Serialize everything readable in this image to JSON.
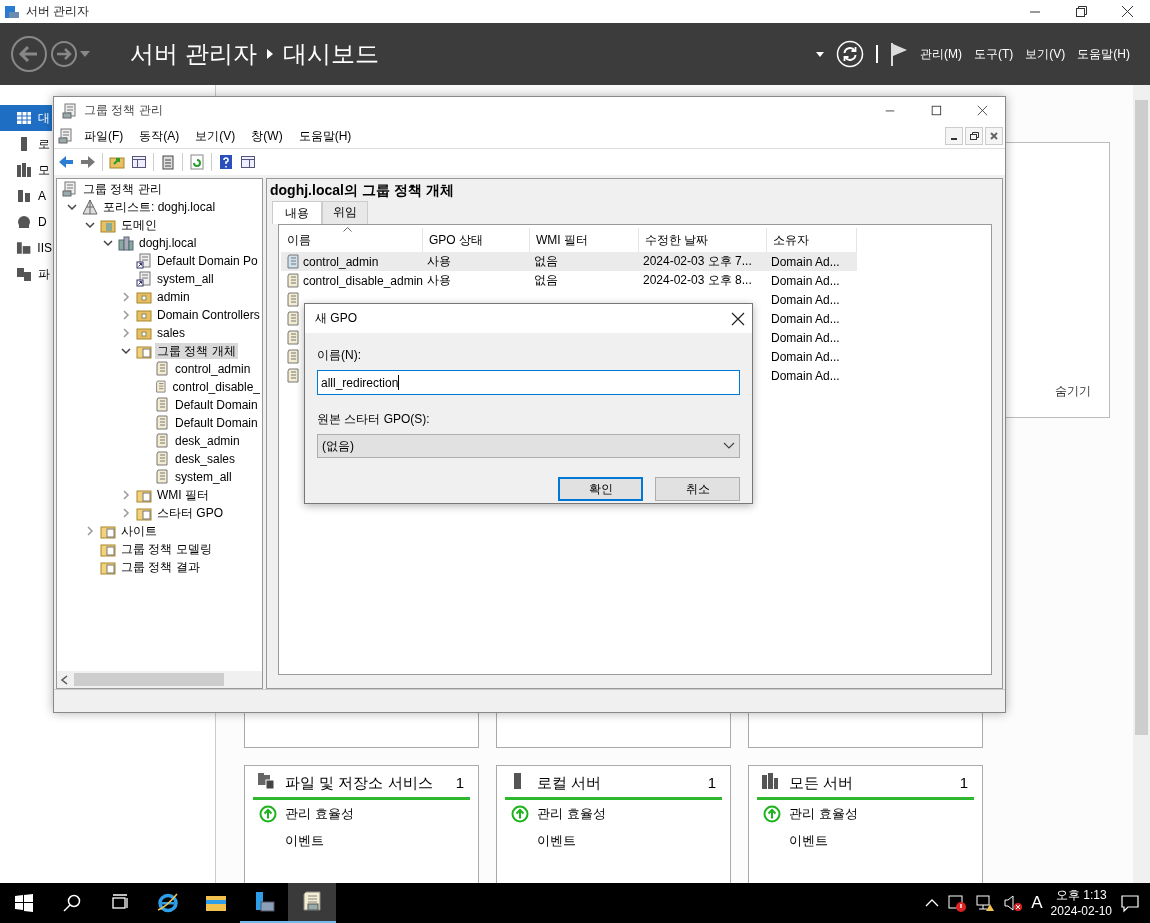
{
  "server_manager": {
    "title": "서버 관리자",
    "breadcrumb": [
      "서버 관리자",
      "대시보드"
    ],
    "menu": [
      "관리(M)",
      "도구(T)",
      "보기(V)",
      "도움말(H)"
    ],
    "sidebar": [
      {
        "label": "대",
        "selected": true
      },
      {
        "label": "로",
        "selected": false
      },
      {
        "label": "모",
        "selected": false
      },
      {
        "label": "A",
        "selected": false
      },
      {
        "label": "D",
        "selected": false
      },
      {
        "label": "IIS",
        "selected": false
      },
      {
        "label": "파",
        "selected": false
      }
    ],
    "hide_label": "숨기기",
    "tiles": [
      {
        "kind": "files",
        "title": "파일 및 저장소 서비스",
        "count": "1",
        "rows": [
          "관리 효율성",
          "이벤트"
        ]
      },
      {
        "kind": "local",
        "title": "로컬 서버",
        "count": "1",
        "rows": [
          "관리 효율성",
          "이벤트"
        ]
      },
      {
        "kind": "all",
        "title": "모든 서버",
        "count": "1",
        "rows": [
          "관리 효율성",
          "이벤트"
        ]
      }
    ]
  },
  "gpm": {
    "title": "그룹 정책 관리",
    "menu": [
      "파일(F)",
      "동작(A)",
      "보기(V)",
      "창(W)",
      "도움말(H)"
    ],
    "tree": [
      {
        "label": "그룹 정책 관리",
        "kind": "console",
        "selected": false,
        "children": [
          {
            "label": "포리스트: doghj.local",
            "kind": "forest",
            "expanded": true,
            "selected": false,
            "children": [
              {
                "label": "도메인",
                "kind": "domains",
                "expanded": true,
                "selected": false,
                "children": [
                  {
                    "label": "doghj.local",
                    "kind": "domain",
                    "expanded": true,
                    "selected": false,
                    "children": [
                      {
                        "label": "Default Domain Po",
                        "kind": "link",
                        "selected": false
                      },
                      {
                        "label": "system_all",
                        "kind": "link",
                        "selected": false
                      },
                      {
                        "label": "admin",
                        "kind": "ou",
                        "expanded": false,
                        "selected": false
                      },
                      {
                        "label": "Domain Controllers",
                        "kind": "ou",
                        "expanded": false,
                        "selected": false
                      },
                      {
                        "label": "sales",
                        "kind": "ou",
                        "expanded": false,
                        "selected": false
                      },
                      {
                        "label": "그룹 정책 개체",
                        "kind": "folder",
                        "expanded": true,
                        "selected": true,
                        "children": [
                          {
                            "label": "control_admin",
                            "kind": "gpo",
                            "selected": false
                          },
                          {
                            "label": "control_disable_",
                            "kind": "gpo",
                            "selected": false
                          },
                          {
                            "label": "Default Domain",
                            "kind": "gpo",
                            "selected": false
                          },
                          {
                            "label": "Default Domain",
                            "kind": "gpo",
                            "selected": false
                          },
                          {
                            "label": "desk_admin",
                            "kind": "gpo",
                            "selected": false
                          },
                          {
                            "label": "desk_sales",
                            "kind": "gpo",
                            "selected": false
                          },
                          {
                            "label": "system_all",
                            "kind": "gpo",
                            "selected": false
                          }
                        ]
                      },
                      {
                        "label": "WMI 필터",
                        "kind": "folder",
                        "expanded": false,
                        "selected": false
                      },
                      {
                        "label": "스타터 GPO",
                        "kind": "folder",
                        "expanded": false,
                        "selected": false
                      }
                    ]
                  }
                ]
              },
              {
                "label": "사이트",
                "kind": "folder",
                "expanded": false,
                "selected": false
              },
              {
                "label": "그룹 정책 모델링",
                "kind": "folder",
                "selected": false
              },
              {
                "label": "그룹 정책 결과",
                "kind": "folder",
                "selected": false
              }
            ]
          }
        ]
      }
    ],
    "pane_title": "doghj.local의 그룹 정책 개체",
    "tabs": [
      {
        "label": "내용",
        "selected": true
      },
      {
        "label": "위임",
        "selected": false
      }
    ],
    "table": {
      "columns": [
        "이름",
        "GPO 상태",
        "WMI 필터",
        "수정한 날짜",
        "소유자"
      ],
      "rows": [
        {
          "selected": true,
          "name": "control_admin",
          "status": "사용",
          "wmi": "없음",
          "date": "2024-02-03 오후 7...",
          "owner": "Domain Ad..."
        },
        {
          "selected": false,
          "name": "control_disable_admin",
          "status": "사용",
          "wmi": "없음",
          "date": "2024-02-03 오후 8...",
          "owner": "Domain Ad..."
        },
        {
          "selected": false,
          "owner": "Domain Ad..."
        },
        {
          "selected": false,
          "owner": "Domain Ad..."
        },
        {
          "selected": false,
          "owner": "Domain Ad..."
        },
        {
          "selected": false,
          "owner": "Domain Ad..."
        },
        {
          "selected": false,
          "owner": "Domain Ad..."
        }
      ]
    }
  },
  "dialog": {
    "title": "새 GPO",
    "name_label": "이름(N):",
    "name_value": "alll_redirection",
    "starter_label": "원본 스타터 GPO(S):",
    "starter_value": "(없음)",
    "buttons": [
      {
        "label": "확인",
        "default": true
      },
      {
        "label": "취소",
        "default": false
      }
    ]
  },
  "taskbar": {
    "apps": [
      {
        "kind": "ie",
        "open": false,
        "selected": false
      },
      {
        "kind": "explorer",
        "open": false,
        "selected": false
      },
      {
        "kind": "server_manager",
        "open": true,
        "selected": false
      },
      {
        "kind": "gpm",
        "open": true,
        "selected": true
      }
    ],
    "ime": "A",
    "time": "오후 1:13",
    "date": "2024-02-10"
  }
}
